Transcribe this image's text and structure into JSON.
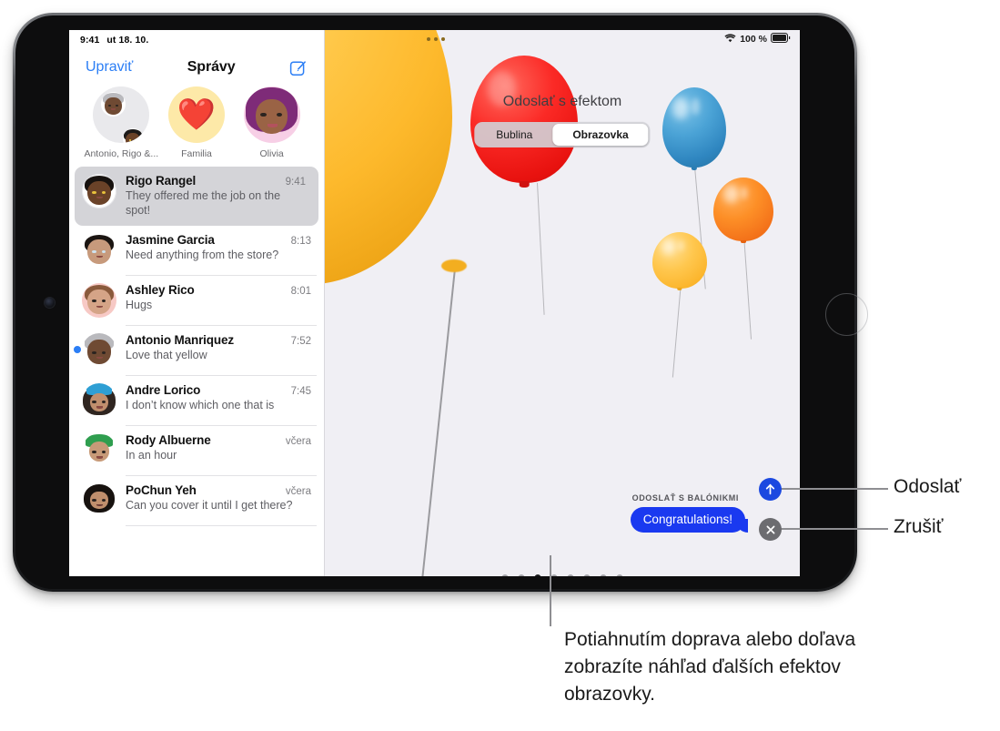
{
  "sidebar": {
    "status": {
      "time": "9:41",
      "date": "ut 18. 10."
    },
    "nav": {
      "edit": "Upraviť",
      "title": "Správy",
      "compose_icon": "compose-icon"
    },
    "pinned": [
      {
        "label": "Antonio, Rigo &...",
        "avatar": "group-memoji"
      },
      {
        "label": "Familia",
        "avatar": "heart-emoji"
      },
      {
        "label": "Olivia",
        "avatar": "olivia-memoji"
      }
    ],
    "conversations": [
      {
        "name": "Rigo Rangel",
        "time": "9:41",
        "preview": "They offered me the job on the spot!",
        "selected": true,
        "unread": false
      },
      {
        "name": "Jasmine Garcia",
        "time": "8:13",
        "preview": "Need anything from the store?",
        "selected": false,
        "unread": false
      },
      {
        "name": "Ashley Rico",
        "time": "8:01",
        "preview": "Hugs",
        "selected": false,
        "unread": false
      },
      {
        "name": "Antonio Manriquez",
        "time": "7:52",
        "preview": "Love that yellow",
        "selected": false,
        "unread": true
      },
      {
        "name": "Andre Lorico",
        "time": "7:45",
        "preview": "I don’t know which one that is",
        "selected": false,
        "unread": false
      },
      {
        "name": "Rody Albuerne",
        "time": "včera",
        "preview": "In an hour",
        "selected": false,
        "unread": false
      },
      {
        "name": "PoChun Yeh",
        "time": "včera",
        "preview": "Can you cover it until I get there?",
        "selected": false,
        "unread": false
      }
    ]
  },
  "main": {
    "status": {
      "battery": "100 %",
      "wifi_icon": "wifi-icon",
      "battery_icon": "battery-full-icon"
    },
    "more_icon": "more-dots-icon",
    "effect_title": "Odoslať s efektom",
    "segments": [
      {
        "label": "Bublina",
        "active": false
      },
      {
        "label": "Obrazovka",
        "active": true
      }
    ],
    "send_with_label": "ODOSLAŤ S BALÓNIKMI",
    "bubble_text": "Congratulations!",
    "page_dots": {
      "count": 8,
      "active_index": 2
    }
  },
  "controls": {
    "send": {
      "label": "Odoslať",
      "icon": "arrow-up-icon",
      "color": "#1b48e0"
    },
    "cancel": {
      "label": "Zrušiť",
      "icon": "close-x-icon",
      "color": "#6c6c70"
    }
  },
  "caption": "Potiahnutím doprava alebo doľava zobrazíte náhľad ďalších efektov obrazovky."
}
